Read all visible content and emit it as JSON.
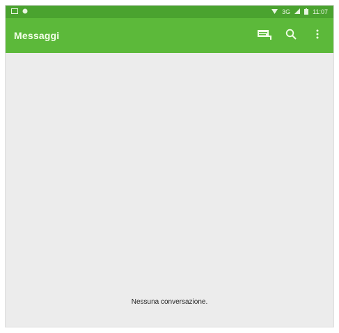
{
  "status_bar": {
    "signal": "3G",
    "battery": "",
    "time": "11:07"
  },
  "app_bar": {
    "title": "Messaggi",
    "icons": [
      "new-message-icon",
      "search-icon",
      "more-vert-icon"
    ]
  },
  "content": {
    "empty_text": "Nessuna conversazione."
  },
  "colors": {
    "status_bar": "#4aa32f",
    "app_bar": "#5cb93a",
    "background": "#ececec"
  }
}
